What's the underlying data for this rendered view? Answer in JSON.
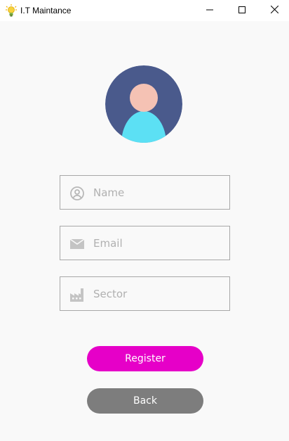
{
  "window": {
    "title": "I.T Maintance",
    "app_icon": "lightbulb-icon",
    "controls": [
      "minimize-icon",
      "maximize-icon",
      "close-icon"
    ]
  },
  "avatar": {
    "icon": "user-avatar-icon",
    "colors": {
      "background": "#4a5a8c",
      "head": "#f5c2b4",
      "body": "#5ce0f4"
    }
  },
  "form": {
    "fields": [
      {
        "icon": "user-circle-icon",
        "placeholder": "Name",
        "value": ""
      },
      {
        "icon": "mail-icon",
        "placeholder": "Email",
        "value": ""
      },
      {
        "icon": "factory-icon",
        "placeholder": "Sector",
        "value": ""
      }
    ],
    "register_label": "Register",
    "back_label": "Back"
  },
  "colors": {
    "register_button": "#e600c8",
    "back_button": "#7d7d7d",
    "field_border": "#a8a8a8",
    "placeholder": "#b0b0b0",
    "background": "#f9f9f9"
  }
}
